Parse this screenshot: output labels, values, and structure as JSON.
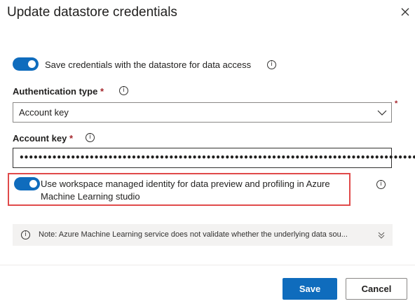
{
  "dialog": {
    "title": "Update datastore credentials"
  },
  "save_credentials": {
    "label": "Save credentials with the datastore for data access",
    "enabled": true
  },
  "auth_type": {
    "label": "Authentication type",
    "required_mark": "*",
    "value": "Account key"
  },
  "account_key": {
    "label": "Account key",
    "required_mark": "*",
    "value": "••••••••••••••••••••••••••••••••••••••••••••••••••••••••••••••••••••••••••••••••••••••"
  },
  "managed_identity": {
    "line1": "Use workspace managed identity for data preview and profiling in Azure",
    "line2": "Machine Learning studio",
    "enabled": true
  },
  "note": {
    "text": "Note: Azure Machine Learning service does not validate whether the underlying data sou..."
  },
  "buttons": {
    "save": "Save",
    "cancel": "Cancel"
  },
  "icons": {
    "info": "i"
  },
  "colors": {
    "accent": "#0f6cbd",
    "highlight_border": "#e04a4a",
    "required": "#a4262c"
  }
}
